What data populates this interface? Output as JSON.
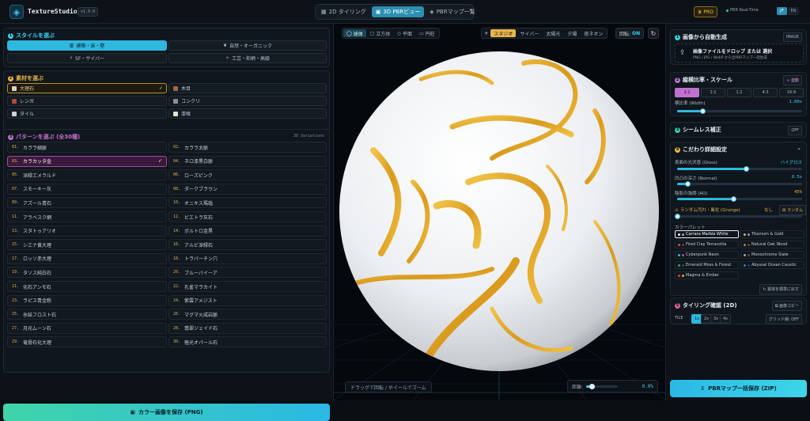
{
  "app": {
    "name": "TextureStudio",
    "version": "v1.0.0"
  },
  "tabs": [
    {
      "label": "2D タイリング",
      "icon": "▦"
    },
    {
      "label": "3D PBRビュー",
      "icon": "▣"
    },
    {
      "label": "PBRマップ一覧",
      "icon": "◈"
    }
  ],
  "header": {
    "pro": "PRO",
    "realtime": "PBR Real-Time",
    "lang_jp": "JP",
    "lang_en": "EN"
  },
  "style": {
    "title": "スタイルを選ぶ",
    "num": "1",
    "items": [
      "建築・床・壁",
      "自然・オーガニック",
      "SF・サイバー",
      "工芸・和柄・高級"
    ]
  },
  "material": {
    "title": "素材を選ぶ",
    "num": "2",
    "items": [
      {
        "label": "大理石",
        "color": "#d8d2c4"
      },
      {
        "label": "木目",
        "color": "#a06a3a"
      },
      {
        "label": "レンガ",
        "color": "#b04a3a"
      },
      {
        "label": "コンクリ",
        "color": "#8a9098"
      },
      {
        "label": "タイル",
        "color": "#c8d4e0"
      },
      {
        "label": "漆喰",
        "color": "#e6e0d4"
      }
    ]
  },
  "pattern": {
    "title": "パターンを選ぶ (全30種)",
    "num": "3",
    "count": "30 Variations",
    "items": [
      [
        "01.",
        "カララ細脈"
      ],
      [
        "02.",
        "カララ太脈"
      ],
      [
        "03.",
        "カラカッタ金"
      ],
      [
        "04.",
        "ネロ漆黒白脈"
      ],
      [
        "05.",
        "深緑エメラルド"
      ],
      [
        "06.",
        "ローズピンク"
      ],
      [
        "07.",
        "スモーキー灰"
      ],
      [
        "08.",
        "ダークブラウン"
      ],
      [
        "09.",
        "アズール青石"
      ],
      [
        "10.",
        "オニキス瑪瑙"
      ],
      [
        "11.",
        "アラベスク網"
      ],
      [
        "12.",
        "ビエトラ灰石"
      ],
      [
        "13.",
        "スタトゥアリオ"
      ],
      [
        "14.",
        "ポルトロ金黒"
      ],
      [
        "15.",
        "シエナ黄大理"
      ],
      [
        "16.",
        "アルビ深緑石"
      ],
      [
        "17.",
        "ロッソ赤大理"
      ],
      [
        "18.",
        "トラバーチン穴"
      ],
      [
        "19.",
        "タソス純白石"
      ],
      [
        "20.",
        "ブルーバイーア"
      ],
      [
        "21.",
        "化石アンモ石"
      ],
      [
        "22.",
        "孔雀マラカイト"
      ],
      [
        "23.",
        "ラピス青金粉"
      ],
      [
        "24.",
        "紫雲アメジスト"
      ],
      [
        "25.",
        "氷結フロスト石"
      ],
      [
        "26.",
        "マグマ火成岩脈"
      ],
      [
        "27.",
        "月光ムーン石"
      ],
      [
        "28.",
        "翡翠ジェイド石"
      ],
      [
        "29.",
        "竜骨石化大理"
      ],
      [
        "30.",
        "極光オパール石"
      ]
    ]
  },
  "save_button": "カラー画像を保存 (PNG)",
  "viewer": {
    "shapes": [
      "球体",
      "立方体",
      "平面",
      "円柱"
    ],
    "lights": [
      "スタジオ",
      "サイバー",
      "太陽光",
      "夕陽",
      "夜ネオン"
    ],
    "rotation_label": "回転:",
    "rotation_value": "ON",
    "hint": "ドラッグで回転 / ホイールでズーム",
    "zoom_label": "距離:",
    "zoom_value": "0.0%",
    "zoom_fraction": 0.18
  },
  "auto": {
    "num": "1",
    "title": "画像から自動生成",
    "badge": "IMAGE",
    "drop_title": "画像ファイルをドロップ または 選択",
    "drop_sub": "PNG / JPG / WebP から全PBRマップ一括生成"
  },
  "aspect": {
    "num": "2",
    "title": "縦横比率・スケール",
    "link": "連動",
    "ratios": [
      "1:1",
      "2:1",
      "1:2",
      "4:3",
      "16:9"
    ],
    "width_label": "横比率 (Width)",
    "width_value": "1.00x",
    "width_fraction": 0.2
  },
  "seamless": {
    "num": "3",
    "title": "シームレス補正",
    "state": "OFF"
  },
  "detail": {
    "num": "4",
    "title": "こだわり詳細設定",
    "gloss_label": "表面の光沢感 (Gloss)",
    "gloss_value": "ハイグロス",
    "gloss_fraction": 0.55,
    "normal_label": "凹凸の深さ (Normal)",
    "normal_value": "0.5x",
    "normal_fraction": 0.08,
    "ao_label": "陰影の強調 (AO)",
    "ao_value": "45%",
    "ao_fraction": 0.45,
    "grunge_label": "ランダム汚れ・風化 (Grunge)",
    "grunge_value": "なし",
    "grunge_random": "ランダム",
    "grunge_fraction": 0.0,
    "palette_label": "カラーパレット",
    "palettes": [
      {
        "label": "Carrara Marble White",
        "c1": "#e6edf3",
        "c2": "#9aa4ae"
      },
      {
        "label": "Titanium & Gold",
        "c1": "#d9b24a",
        "c2": "#8f9aa6"
      },
      {
        "label": "Fired Clay Terracotta",
        "c1": "#c0553a",
        "c2": "#7a3020"
      },
      {
        "label": "Natural Oak Wood",
        "c1": "#b57a3e",
        "c2": "#6a4420"
      },
      {
        "label": "Cyberpunk Neon",
        "c1": "#2fb8df",
        "c2": "#b040c0"
      },
      {
        "label": "Monochrome Slate",
        "c1": "#9aa4ae",
        "c2": "#4a525a"
      },
      {
        "label": "Emerald Moss & Forest",
        "c1": "#3aa060",
        "c2": "#1f5a30"
      },
      {
        "label": "Abyssal Ocean Caustic",
        "c1": "#2a7ad0",
        "c2": "#1a3a70"
      },
      {
        "label": "Magma & Ember",
        "c1": "#e04020",
        "c2": "#f0a030"
      }
    ],
    "reset": "異常を標準に戻す"
  },
  "tiling": {
    "num": "5",
    "title": "タイリング確認 (2D)",
    "copy": "画像コピー",
    "tile_label": "TILE",
    "tile_options": [
      "1x",
      "2x",
      "3x",
      "4x"
    ],
    "grid": "グリッド線: OFF"
  },
  "zip_button": "PBRマップ一括保存 (ZIP)",
  "colors": {
    "accent": "#2fb8df",
    "gold": "#e8b44a",
    "selected_pattern": "#a04aa0"
  }
}
